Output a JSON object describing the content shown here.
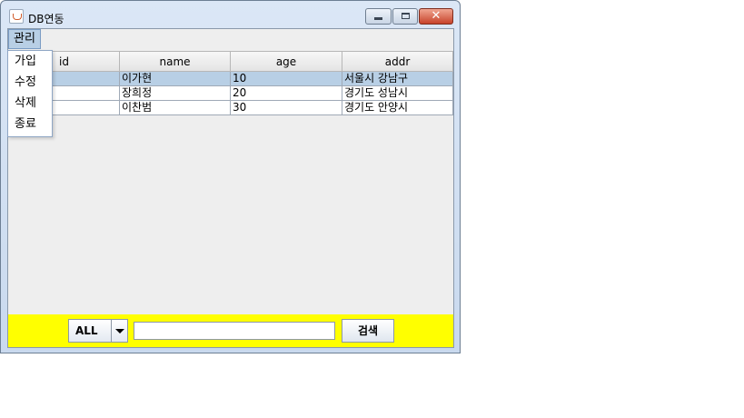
{
  "window": {
    "title": "DB연동"
  },
  "menu": {
    "title": "관리",
    "items": [
      "가입",
      "수정",
      "삭제",
      "종료"
    ]
  },
  "table": {
    "columns": [
      "id",
      "name",
      "age",
      "addr"
    ],
    "rows": [
      [
        "",
        "이가현",
        "10",
        "서울시 강남구"
      ],
      [
        "",
        "장희정",
        "20",
        "경기도 성남시"
      ],
      [
        "",
        "이찬범",
        "30",
        "경기도 안양시"
      ]
    ]
  },
  "search": {
    "combo_value": "ALL",
    "input_value": "",
    "button_label": "검색"
  }
}
